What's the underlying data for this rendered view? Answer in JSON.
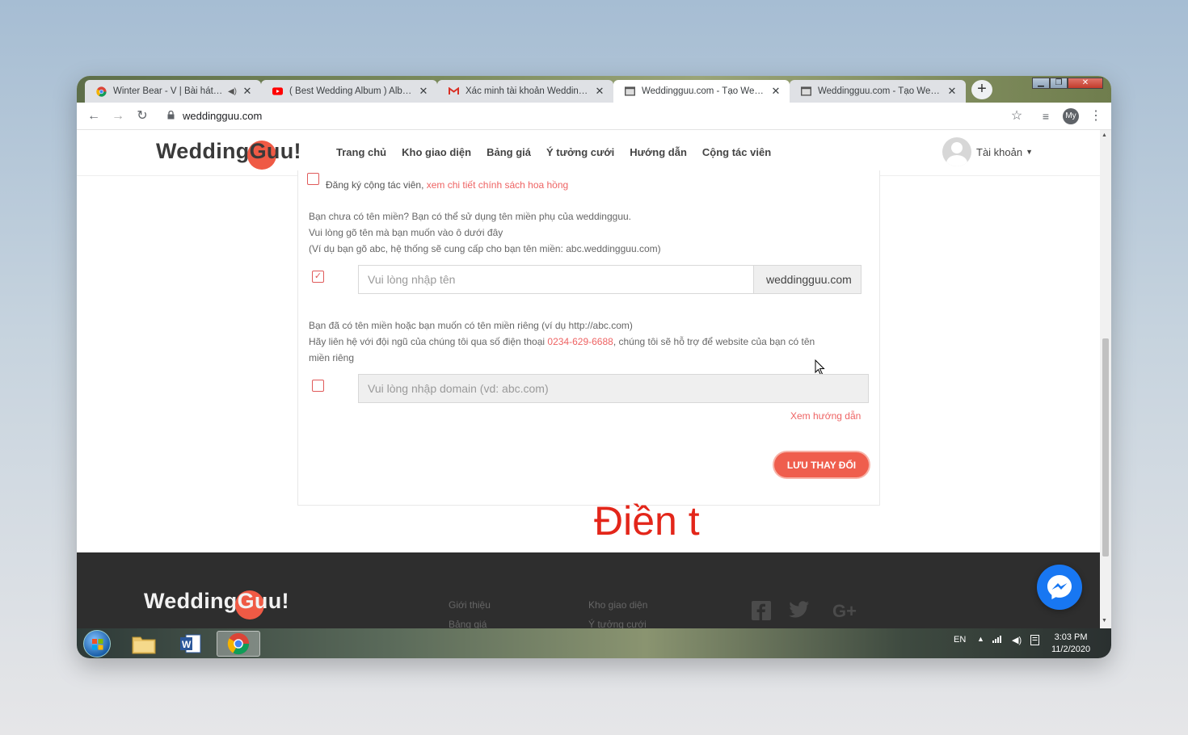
{
  "browser": {
    "tabs": [
      {
        "title": "Winter Bear - V | Bài hát, lyri",
        "icon": "chrome-icon",
        "active": false,
        "audio": true
      },
      {
        "title": "( Best Wedding Album ) Album",
        "icon": "youtube-icon",
        "active": false,
        "audio": false
      },
      {
        "title": "Xác minh tài khoản Wedding G",
        "icon": "gmail-icon",
        "active": false,
        "audio": false
      },
      {
        "title": "Weddingguu.com - Tạo Websit",
        "icon": "page-icon",
        "active": true,
        "audio": false
      },
      {
        "title": "Weddingguu.com - Tạo Websit",
        "icon": "page-icon",
        "active": false,
        "audio": false
      }
    ],
    "new_tab_label": "+",
    "url": "weddingguu.com",
    "profile_initials": "My"
  },
  "site": {
    "logo_prefix": "Wedding",
    "logo_gu": "Gu",
    "logo_suffix": "u!",
    "nav": [
      "Trang chủ",
      "Kho giao diện",
      "Bảng giá",
      "Ý tưởng cưới",
      "Hướng dẫn",
      "Cộng tác viên"
    ],
    "account_label": "Tài khoản"
  },
  "form": {
    "register_label": "Đăng ký cộng tác viên,",
    "register_link": "xem chi tiết chính sách hoa hồng",
    "subdomain_lines": [
      "Bạn chưa có tên miền? Bạn có thể sử dụng tên miền phụ của weddingguu.",
      "Vui lòng gõ tên mà bạn muốn vào ô dưới đây",
      "(Ví dụ bạn gõ abc, hệ thống sẽ cung cấp cho bạn tên miền: abc.weddingguu.com)"
    ],
    "subdomain_checked": true,
    "subdomain_placeholder": "Vui lòng nhập tên",
    "subdomain_suffix": "weddingguu.com",
    "custom_line1": "Bạn đã có tên miền hoặc bạn muốn có tên miền riêng (ví dụ http://abc.com)",
    "custom_line2_a": "Hãy liên hệ với đội ngũ của chúng tôi qua số điện thoại",
    "custom_phone": "0234-629-6688",
    "custom_line2_b": ", chúng tôi sẽ hỗ trợ để website của bạn có tên",
    "custom_line3": "miền riêng",
    "custom_checked": false,
    "domain_placeholder": "Vui lòng nhập domain (vd: abc.com)",
    "guide_link": "Xem hướng dẫn",
    "save_button": "LƯU THAY ĐỔI"
  },
  "overlay_caption": "Điền t",
  "footer": {
    "col1": [
      "Giới thiệu",
      "Bảng giá"
    ],
    "col2": [
      "Kho giao diện",
      "Ý tưởng cưới"
    ],
    "social": [
      "facebook-icon",
      "twitter-icon",
      "google-plus-icon"
    ]
  },
  "taskbar": {
    "language": "EN",
    "time": "3:03 PM",
    "date": "11/2/2020"
  },
  "colors": {
    "brand": "#ef5a45",
    "link": "#ee6363",
    "footer_bg": "#2e2e2e",
    "messenger": "#1877f2"
  }
}
